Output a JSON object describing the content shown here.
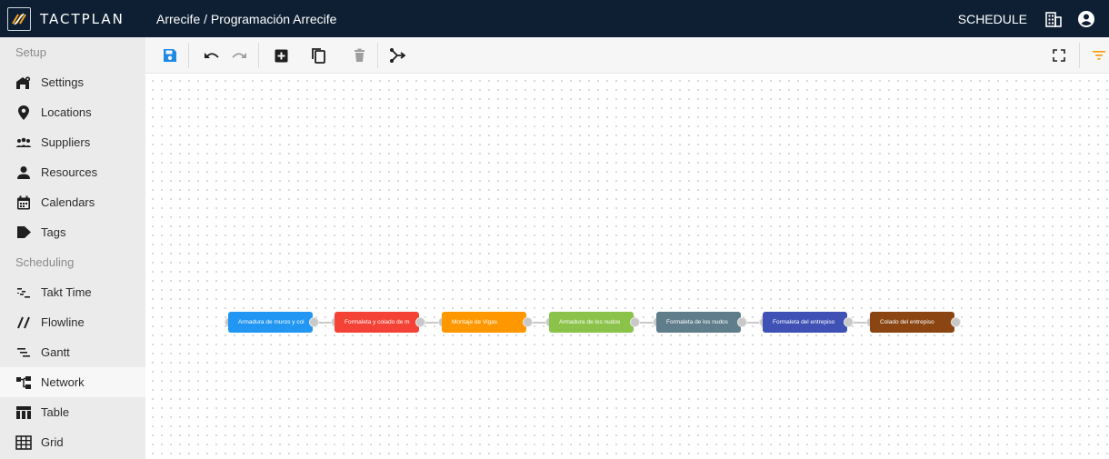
{
  "header": {
    "logo_text": "TACTPLAN",
    "breadcrumb": "Arrecife / Programación Arrecife",
    "schedule_label": "SCHEDULE"
  },
  "sidebar": {
    "setup_title": "Setup",
    "setup_items": [
      {
        "label": "Settings",
        "icon": "settings-icon"
      },
      {
        "label": "Locations",
        "icon": "location-pin-icon"
      },
      {
        "label": "Suppliers",
        "icon": "suppliers-icon"
      },
      {
        "label": "Resources",
        "icon": "person-icon"
      },
      {
        "label": "Calendars",
        "icon": "calendar-icon"
      },
      {
        "label": "Tags",
        "icon": "tag-icon"
      }
    ],
    "scheduling_title": "Scheduling",
    "scheduling_items": [
      {
        "label": "Takt Time",
        "icon": "takt-time-icon"
      },
      {
        "label": "Flowline",
        "icon": "flowline-icon"
      },
      {
        "label": "Gantt",
        "icon": "gantt-icon"
      },
      {
        "label": "Network",
        "icon": "network-icon",
        "active": true
      },
      {
        "label": "Table",
        "icon": "table-icon"
      },
      {
        "label": "Grid",
        "icon": "grid-icon"
      }
    ]
  },
  "toolbar": {
    "buttons": [
      "save-icon",
      "undo-icon",
      "redo-icon",
      "add-box-icon",
      "copy-icon",
      "delete-icon",
      "link-activities-icon",
      "fit-screen-icon",
      "filter-icon"
    ]
  },
  "network": {
    "nodes": [
      {
        "label": "Armadura de muros y col",
        "color": "#2196f3"
      },
      {
        "label": "Formaleta y colado de m",
        "color": "#f44336"
      },
      {
        "label": "Montaje de Vigas",
        "color": "#ff9800"
      },
      {
        "label": "Armadura de los nudos",
        "color": "#8bc34a"
      },
      {
        "label": "Formaleta de los nudos",
        "color": "#607d8b"
      },
      {
        "label": "Formaleta del entrepiso",
        "color": "#3f51b5"
      },
      {
        "label": "Colado del entrepiso",
        "color": "#8b4513"
      }
    ]
  },
  "colors": {
    "header_bg": "#0e1f33",
    "accent_blue": "#1e88e5",
    "filter_orange": "#ff9800"
  }
}
